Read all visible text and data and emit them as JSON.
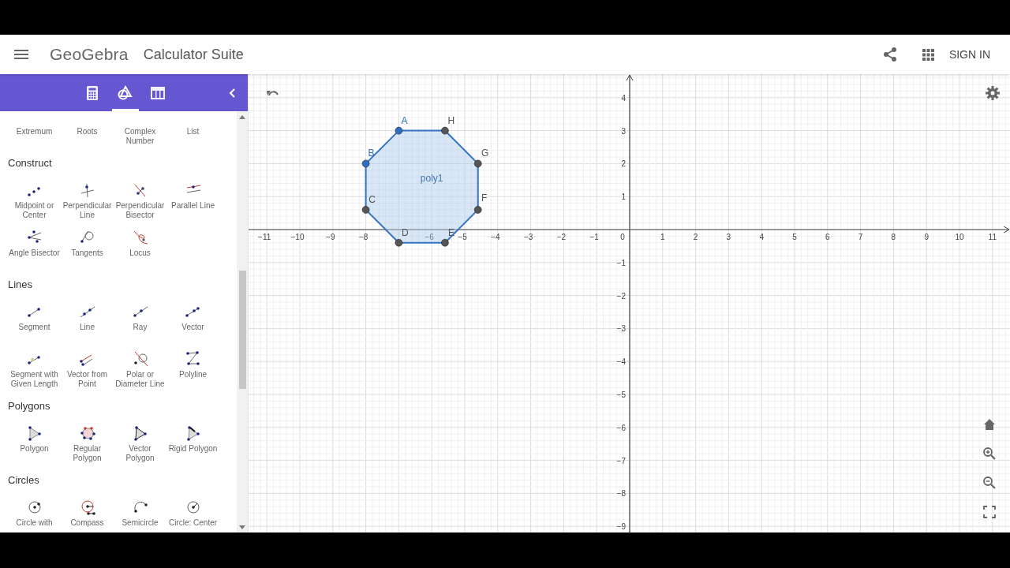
{
  "header": {
    "logo": "GeoGebra",
    "title": "Calculator Suite",
    "sign_in": "SIGN IN"
  },
  "perspective_tabs": [
    {
      "kind": "calculator",
      "selected": false
    },
    {
      "kind": "geometry",
      "selected": true
    },
    {
      "kind": "table",
      "selected": false
    }
  ],
  "tool_sections": [
    {
      "tools": [
        {
          "label": "Extremum"
        },
        {
          "label": "Roots"
        },
        {
          "label": "Complex Number"
        },
        {
          "label": "List"
        }
      ]
    },
    {
      "title": "Construct",
      "tools": [
        {
          "label": "Midpoint or Center"
        },
        {
          "label": "Perpendicular Line"
        },
        {
          "label": "Perpendicular Bisector"
        },
        {
          "label": "Parallel Line"
        },
        {
          "label": "Angle Bisector"
        },
        {
          "label": "Tangents"
        },
        {
          "label": "Locus"
        }
      ]
    },
    {
      "title": "Lines",
      "tools": [
        {
          "label": "Segment"
        },
        {
          "label": "Line"
        },
        {
          "label": "Ray"
        },
        {
          "label": "Vector"
        },
        {
          "label": "Segment with Given Length"
        },
        {
          "label": "Vector from Point"
        },
        {
          "label": "Polar or Diameter Line"
        },
        {
          "label": "Polyline"
        }
      ]
    },
    {
      "title": "Polygons",
      "tools": [
        {
          "label": "Polygon"
        },
        {
          "label": "Regular Polygon"
        },
        {
          "label": "Vector Polygon"
        },
        {
          "label": "Rigid Polygon"
        }
      ]
    },
    {
      "title": "Circles",
      "tools": [
        {
          "label": "Circle with"
        },
        {
          "label": "Compass"
        },
        {
          "label": "Semicircle"
        },
        {
          "label": "Circle: Center"
        }
      ]
    }
  ],
  "graphics": {
    "x_ticks": [
      "−11",
      "−10",
      "−9",
      "−8",
      "−6",
      "−5",
      "−4",
      "−3",
      "−2",
      "−1",
      "0",
      "1",
      "2",
      "3",
      "4",
      "5",
      "6",
      "7",
      "8",
      "9",
      "10",
      "11"
    ],
    "y_ticks": [
      "4",
      "3",
      "2",
      "1",
      "−1",
      "−2",
      "−3",
      "−4",
      "−5",
      "−6",
      "−7",
      "−8",
      "−9"
    ],
    "polygon": {
      "label": "poly1"
    },
    "points": [
      {
        "label": "A",
        "color": "#2e6fc4"
      },
      {
        "label": "B",
        "color": "#2e6fc4"
      },
      {
        "label": "C",
        "color": "#555555"
      },
      {
        "label": "D",
        "color": "#555555"
      },
      {
        "label": "E",
        "color": "#555555"
      },
      {
        "label": "F",
        "color": "#555555"
      },
      {
        "label": "G",
        "color": "#555555"
      },
      {
        "label": "H",
        "color": "#555555"
      }
    ]
  }
}
